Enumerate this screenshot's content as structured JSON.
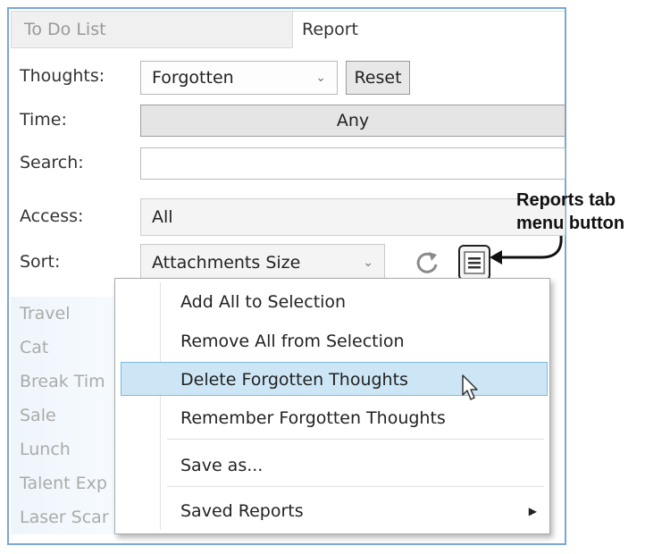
{
  "tabs": [
    {
      "label": "To Do List"
    },
    {
      "label": "Report"
    }
  ],
  "form": {
    "thoughts_label": "Thoughts:",
    "thoughts_value": "Forgotten",
    "reset_label": "Reset",
    "time_label": "Time:",
    "time_value": "Any",
    "search_label": "Search:",
    "search_value": "",
    "access_label": "Access:",
    "access_value": "All",
    "sort_label": "Sort:",
    "sort_value": "Attachments Size"
  },
  "list_items": [
    "Travel",
    "Cat",
    "Break Tim",
    "Sale",
    "Lunch",
    "Talent Exp",
    "Laser Scar"
  ],
  "context_menu": {
    "items": [
      "Add All to Selection",
      "Remove All from Selection",
      "Delete Forgotten Thoughts",
      "Remember Forgotten Thoughts",
      "Save as...",
      "Saved Reports"
    ],
    "highlighted": "Delete Forgotten Thoughts"
  },
  "callout": {
    "line1": "Reports tab",
    "line2": "menu button"
  },
  "icons": {
    "refresh": "refresh-icon",
    "menu": "hamburger-menu-icon",
    "chevron": "chevron-down-icon",
    "submenu": "triangle-right-icon",
    "cursor": "mouse-pointer-icon"
  },
  "colors": {
    "window_border": "#7aa7d6",
    "highlight_bg": "#cde6f5",
    "highlight_border": "#7fb8de",
    "disabled_text": "#aaaaaa"
  }
}
